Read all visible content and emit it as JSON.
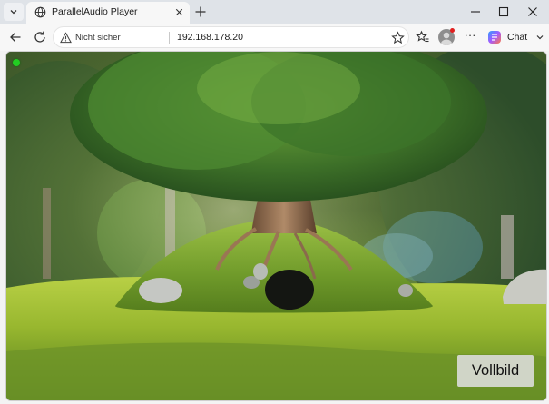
{
  "browser": {
    "tab": {
      "title": "ParallelAudio Player"
    },
    "address_bar": {
      "security_label": "Nicht sicher",
      "url": "192.168.178.20"
    },
    "chat_label": "Chat",
    "icons": [
      "tab-actions-chevron-icon",
      "globe-icon",
      "close-icon",
      "plus-icon",
      "minimize-icon",
      "maximize-icon",
      "close-icon",
      "back-arrow-icon",
      "reload-icon",
      "warning-icon",
      "star-icon",
      "favorites-icon",
      "profile-icon",
      "more-icon",
      "copilot-icon",
      "chevron-down-icon"
    ]
  },
  "player": {
    "fullscreen_label": "Vollbild",
    "status_color": "#22cc22"
  },
  "colors": {
    "accent": "#2f6fdc",
    "warning": "#444444",
    "record_dot": "#e02020"
  }
}
